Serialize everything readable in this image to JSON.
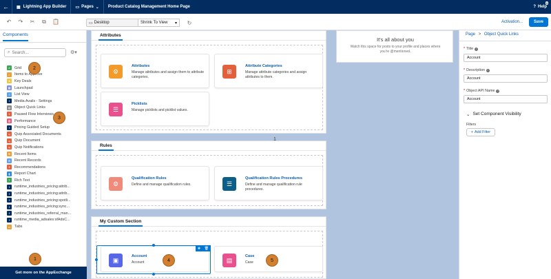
{
  "topbar": {
    "app_name": "Lightning App Builder",
    "pages_label": "Pages",
    "page_title": "Product Catalog Management Home Page",
    "help_label": "Help",
    "help_badge": "3"
  },
  "toolbar": {
    "device": "Desktop",
    "view_mode": "Shrink To View",
    "activation_label": "Activation...",
    "save_label": "Save"
  },
  "left_panel": {
    "tab_label": "Components",
    "search_placeholder": "Search...",
    "items": [
      {
        "label": "Grid",
        "color": "#3ba755",
        "glyph": "#"
      },
      {
        "label": "Items to Approve",
        "color": "#e3a23c",
        "glyph": "✓"
      },
      {
        "label": "Key Deals",
        "color": "#f4c542",
        "glyph": "★"
      },
      {
        "label": "Launchpad",
        "color": "#7f8de1",
        "glyph": "▦"
      },
      {
        "label": "List View",
        "color": "#5ea1e8",
        "glyph": "≡"
      },
      {
        "label": "Media Avails - Settings",
        "color": "#032d60",
        "glyph": "f"
      },
      {
        "label": "Object Quick Links",
        "color": "#8a8a8a",
        "glyph": "▤"
      },
      {
        "label": "Paused Flow Interviews",
        "color": "#e3603c",
        "glyph": "⏸"
      },
      {
        "label": "Performance",
        "color": "#e05a7b",
        "glyph": "▥"
      },
      {
        "label": "Pricing Guided Setup",
        "color": "#032d60",
        "glyph": "f"
      },
      {
        "label": "Quip Associated Documents",
        "color": "#e3603c",
        "glyph": "q"
      },
      {
        "label": "Quip Document",
        "color": "#e3603c",
        "glyph": "q"
      },
      {
        "label": "Quip Notifications",
        "color": "#e3603c",
        "glyph": "q"
      },
      {
        "label": "Recent Items",
        "color": "#e3a23c",
        "glyph": "☰"
      },
      {
        "label": "Recent Records",
        "color": "#5ea1e8",
        "glyph": "☰"
      },
      {
        "label": "Recommendations",
        "color": "#e3603c",
        "glyph": "✦"
      },
      {
        "label": "Report Chart",
        "color": "#2e8ad8",
        "glyph": "▮"
      },
      {
        "label": "Rich Text",
        "color": "#3ba755",
        "glyph": "T"
      },
      {
        "label": "runtime_industries_pricing:attrib...",
        "color": "#032d60",
        "glyph": "f"
      },
      {
        "label": "runtime_industries_pricing:attrib...",
        "color": "#032d60",
        "glyph": "f"
      },
      {
        "label": "runtime_industries_pricing:spotli...",
        "color": "#032d60",
        "glyph": "f"
      },
      {
        "label": "runtime_industries_pricing:sync...",
        "color": "#032d60",
        "glyph": "f"
      },
      {
        "label": "runtime_industries_referral_man...",
        "color": "#032d60",
        "glyph": "f"
      },
      {
        "label": "runtime_media_adsales:sfAdsC...",
        "color": "#032d60",
        "glyph": "f"
      },
      {
        "label": "Tabs",
        "color": "#e3a23c",
        "glyph": "▭"
      }
    ],
    "appexchange_label": "Get more on the AppExchange"
  },
  "canvas": {
    "sections": [
      {
        "title": "Attributes",
        "tiles": [
          {
            "title": "Attributes",
            "desc": "Manage attributes and assign them to attribute categories.",
            "color": "#f39a2a",
            "glyph": "⚙"
          },
          {
            "title": "Attribute Categories",
            "desc": "Manage attribute categories and assign attributes to them.",
            "color": "#e3603c",
            "glyph": "⊞"
          },
          {
            "title": "Picklists",
            "desc": "Manage picklists and picklist values.",
            "color": "#e9508e",
            "glyph": "☰"
          }
        ]
      },
      {
        "title": "Rules",
        "tiles": [
          {
            "title": "Qualification Rules",
            "desc": "Define and manage qualification rules.",
            "color": "#f08a7a",
            "glyph": "⚙"
          },
          {
            "title": "Qualification Rules Procedures",
            "desc": "Define and manage qualification rule procedures.",
            "color": "#0d5e88",
            "glyph": "☰"
          }
        ]
      },
      {
        "title": "My Custom Section",
        "tiles": [
          {
            "title": "Account",
            "desc": "Account",
            "color": "#5867e8",
            "glyph": "▣"
          },
          {
            "title": "Case",
            "desc": "Case",
            "color": "#e9508e",
            "glyph": "▤"
          }
        ]
      }
    ],
    "about": {
      "title": "It's all about you",
      "desc": "Watch this space for posts to your profile and places where you're @mentioned."
    },
    "page_number": "1"
  },
  "right_panel": {
    "crumb_page": "Page",
    "crumb_sep": ">",
    "crumb_current": "Object Quick Links",
    "fields": [
      {
        "label": "Title",
        "value": "Account"
      },
      {
        "label": "Description",
        "value": "Account"
      },
      {
        "label": "Object API Name",
        "value": "Account"
      }
    ],
    "visibility_label": "Set Component Visibility",
    "filters_label": "Filters",
    "add_filter_label": "Add Filter"
  },
  "callouts": [
    "1",
    "2",
    "3",
    "4",
    "5"
  ],
  "colors": {
    "brand_dark": "#032d60",
    "accent": "#0176d3",
    "callout": "#d2802f"
  }
}
